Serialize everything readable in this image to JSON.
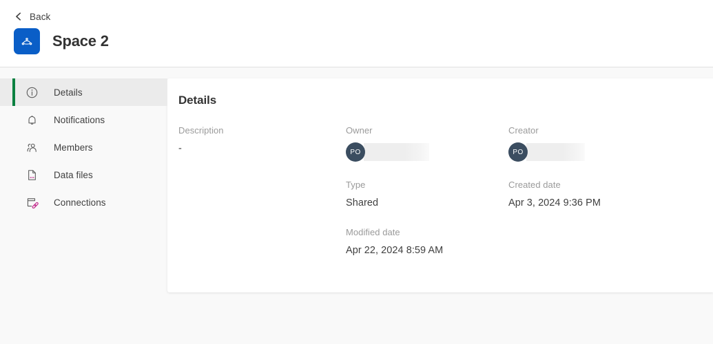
{
  "header": {
    "back_label": "Back",
    "back_icon": "chevron-left-icon",
    "space_icon": "space-logo-icon",
    "title": "Space 2",
    "accent_color": "#0a5ec7"
  },
  "sidebar": {
    "active_indicator_color": "#0a8040",
    "items": [
      {
        "label": "Details",
        "icon": "info-circle-icon",
        "active": true
      },
      {
        "label": "Notifications",
        "icon": "bell-icon",
        "active": false
      },
      {
        "label": "Members",
        "icon": "members-icon",
        "active": false
      },
      {
        "label": "Data files",
        "icon": "data-file-icon",
        "active": false
      },
      {
        "label": "Connections",
        "icon": "connections-icon",
        "active": false
      }
    ]
  },
  "main": {
    "panel_title": "Details",
    "fields": {
      "description": {
        "label": "Description",
        "value": "-"
      },
      "owner": {
        "label": "Owner",
        "avatar_initials": "PO",
        "value": ""
      },
      "creator": {
        "label": "Creator",
        "avatar_initials": "PO",
        "value": ""
      },
      "type": {
        "label": "Type",
        "value": "Shared"
      },
      "created": {
        "label": "Created date",
        "value": "Apr 3, 2024 9:36 PM"
      },
      "modified": {
        "label": "Modified date",
        "value": "Apr 22, 2024 8:59 AM"
      }
    },
    "avatar_color": "#3b4d60"
  }
}
